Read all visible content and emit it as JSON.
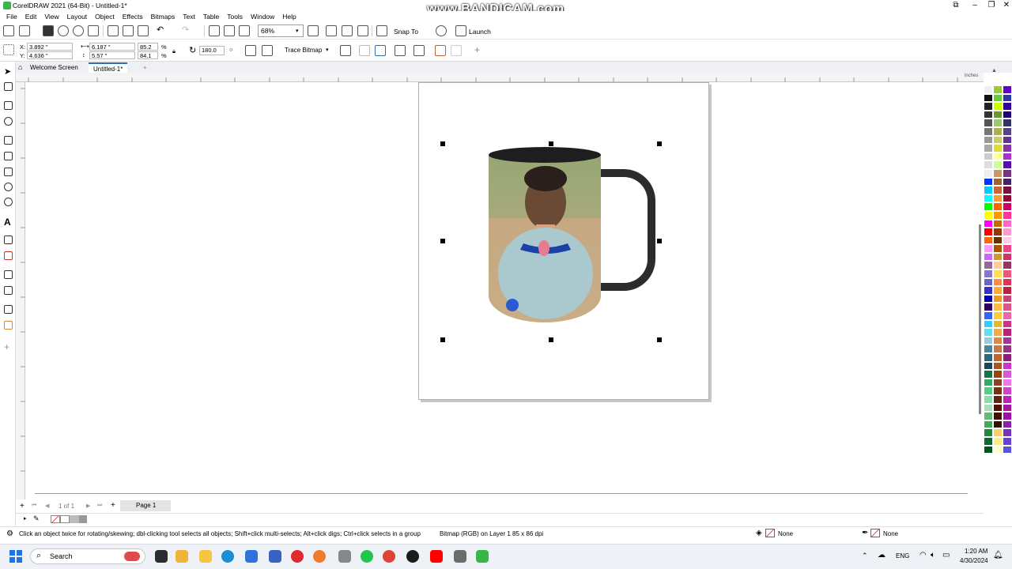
{
  "window": {
    "title": "CorelDRAW 2021 (64-Bit) - Untitled-1*",
    "watermark": "www.BANDICAM.com"
  },
  "menu": [
    "File",
    "Edit",
    "View",
    "Layout",
    "Object",
    "Effects",
    "Bitmaps",
    "Text",
    "Table",
    "Tools",
    "Window",
    "Help"
  ],
  "toolbar": {
    "zoom": "68%",
    "snap_to": "Snap To",
    "launch": "Launch"
  },
  "propbar": {
    "x_label": "X:",
    "x": "3.892 \"",
    "y_label": "Y:",
    "y": "4.636 \"",
    "w": "6.187 \"",
    "h": "5.57 \"",
    "scale_w": "85.2",
    "scale_h": "84.1",
    "pct_symbol": "%",
    "rotation": "180.0",
    "trace_bitmap": "Trace Bitmap"
  },
  "tabs": {
    "welcome": "Welcome Screen",
    "doc": "Untitled-1*",
    "add": "+"
  },
  "ruler": {
    "unit": "inches"
  },
  "pager": {
    "count": "1 of 1",
    "page_tab": "Page 1"
  },
  "status": {
    "hint": "Click an object twice for rotating/skewing; dbl-clicking tool selects all objects; Shift+click multi-selects; Alt+click digs; Ctrl+click selects in a group",
    "info": "Bitmap (RGB) on Layer 1 85 x 86 dpi",
    "fill": "None",
    "outline": "None"
  },
  "taskbar": {
    "search": "Search",
    "lang": "ENG",
    "time": "1:20 AM",
    "date": "4/30/2024"
  },
  "palette_colors": [
    "#f0f0f0",
    "#99cc33",
    "#6600cc",
    "#111111",
    "#66cc33",
    "#3333aa",
    "#222222",
    "#ccff00",
    "#330099",
    "#333333",
    "#669933",
    "#220077",
    "#555555",
    "#99cc66",
    "#333366",
    "#777777",
    "#aab050",
    "#554488",
    "#999999",
    "#cccc66",
    "#663399",
    "#aaaaaa",
    "#dddd33",
    "#8833aa",
    "#cccccc",
    "#ffff99",
    "#aa33cc",
    "#dddddd",
    "#ccff99",
    "#5511aa",
    "#eeeeee",
    "#cc9966",
    "#773388",
    "#0033ff",
    "#996633",
    "#442266",
    "#00ccff",
    "#cc6633",
    "#771144",
    "#00ffff",
    "#ff9933",
    "#990033",
    "#00ff00",
    "#ff6600",
    "#cc0066",
    "#ffff00",
    "#ff9900",
    "#ff3399",
    "#ff00ff",
    "#cc6600",
    "#ff66cc",
    "#ff0000",
    "#993300",
    "#ff99cc",
    "#ff6600",
    "#663300",
    "#ffccee",
    "#ff99ff",
    "#aa5500",
    "#ee4488",
    "#cc66ff",
    "#cc9933",
    "#cc3366",
    "#996699",
    "#ffcc99",
    "#993366",
    "#8877cc",
    "#ffdd55",
    "#ee5577",
    "#6666cc",
    "#ff8844",
    "#dd3355",
    "#3333cc",
    "#ffaa33",
    "#bb2244",
    "#0000aa",
    "#ee9922",
    "#cc4477",
    "#330066",
    "#ffbb44",
    "#dd5588",
    "#3366ff",
    "#ffcc33",
    "#ee66aa",
    "#33ccff",
    "#ddbb33",
    "#cc3388",
    "#66ddee",
    "#eeaa55",
    "#bb2277",
    "#99ccdd",
    "#dd8844",
    "#aa3399",
    "#448899",
    "#cc7744",
    "#993388",
    "#336677",
    "#bb6633",
    "#882277",
    "#224455",
    "#aa5522",
    "#cc33cc",
    "#117744",
    "#994411",
    "#dd55dd",
    "#33aa66",
    "#884422",
    "#ee77ee",
    "#55cc88",
    "#773311",
    "#cc44cc",
    "#88ddaa",
    "#662211",
    "#bb22bb",
    "#aaddbb",
    "#551100",
    "#aa11aa",
    "#66bb77",
    "#441100",
    "#9911aa",
    "#44aa55",
    "#331100",
    "#8822aa",
    "#228844",
    "#ffcc66",
    "#7733bb",
    "#116633",
    "#ffee88",
    "#6644cc",
    "#005522",
    "#ffffcc",
    "#5555dd"
  ]
}
